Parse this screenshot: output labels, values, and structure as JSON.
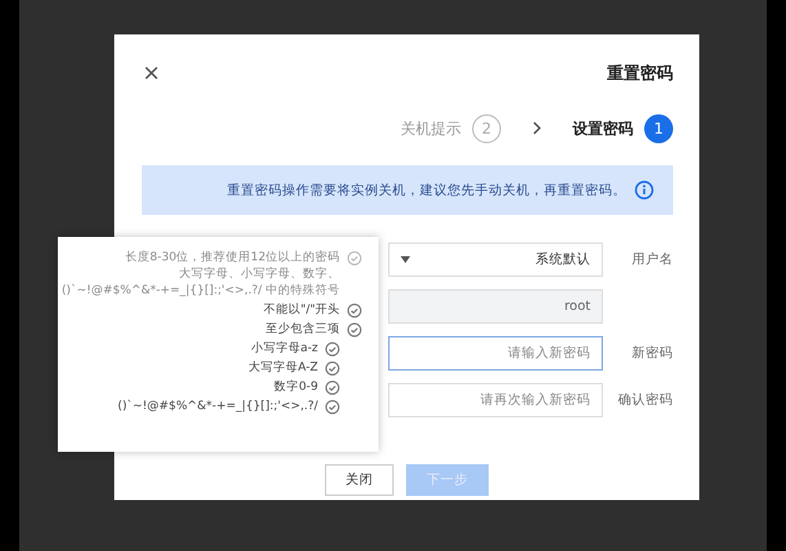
{
  "dialog": {
    "title": "重置密码",
    "steps": [
      {
        "number": "2",
        "label": "关机提示",
        "selected": false
      },
      {
        "number": "1",
        "label": "设置密码",
        "selected": true
      }
    ],
    "alert": "重置密码操作需要将实例关机，建议您先手动关机，再重置密码。",
    "fields": [
      {
        "label": "用户名",
        "kind": "select",
        "value": "系统默认"
      },
      {
        "kind": "readonly",
        "value": "root"
      },
      {
        "label": "新密码",
        "kind": "input",
        "placeholder": "请输入新密码",
        "focused": true
      },
      {
        "label": "确认密码",
        "kind": "input",
        "placeholder": "请再次输入新密码",
        "focused": false
      }
    ],
    "buttons": [
      {
        "label": "关闭",
        "kind": "default",
        "disabled": false
      },
      {
        "label": "下一步",
        "kind": "primary",
        "disabled": true
      }
    ]
  },
  "tooltip": {
    "rules": [
      {
        "lines": [
          "长度8-30位，推荐使用12位以上的密码",
          "大写字母、小写字母、数字、",
          "()`~!@#$%^&*-+=_|{}[]:;'<>,.?/ 中的特殊符号"
        ],
        "dimmed": true
      },
      {
        "lines": [
          "不能以\"/\"开头"
        ],
        "dimmed": false
      },
      {
        "lines": [
          "至少包含三项"
        ],
        "dimmed": false,
        "children": [
          {
            "lines": [
              "小写字母a-z"
            ],
            "dimmed": false
          },
          {
            "lines": [
              "大写字母A-Z"
            ],
            "dimmed": false
          },
          {
            "lines": [
              "数字0-9"
            ],
            "dimmed": false
          },
          {
            "lines": [
              "()`~!@#$%^&*-+=_|{}[]:;'<>,.?/"
            ],
            "dimmed": false
          }
        ]
      }
    ]
  }
}
